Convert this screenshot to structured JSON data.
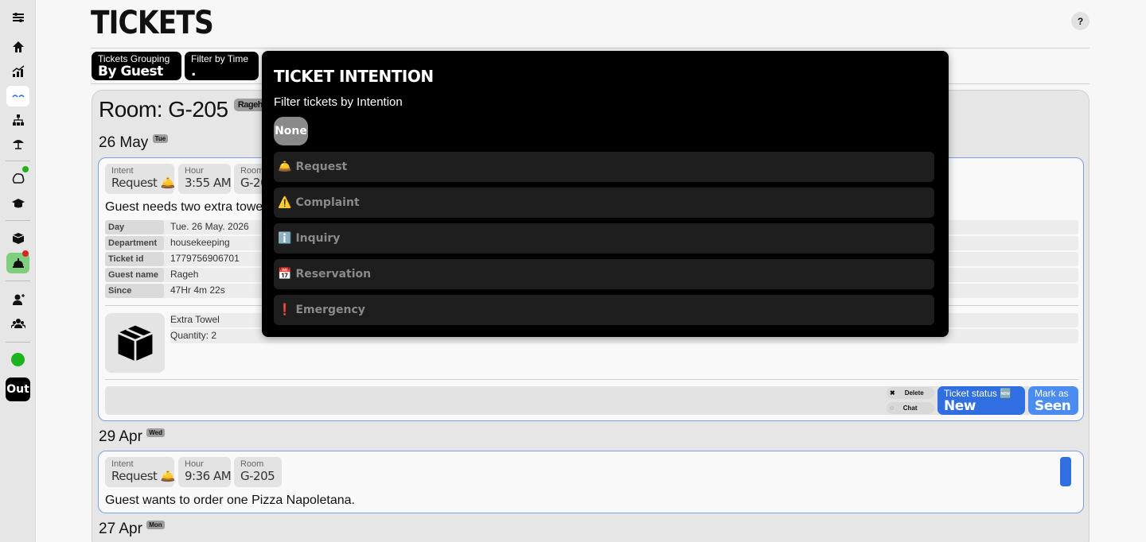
{
  "header": {
    "title": "TICKETS",
    "help_label": "?"
  },
  "filters": {
    "grouping": {
      "label": "Tickets Grouping",
      "value": "By Guest"
    },
    "time": {
      "label": "Filter by Time",
      "value": "."
    }
  },
  "sidebar": {
    "items": [
      "menu-icon",
      "home-icon",
      "chart-icon",
      "logo-icon",
      "org-chart-icon",
      "beach-umbrella-icon",
      "brain-icon",
      "graduation-cap-icon",
      "box-icon",
      "bell-service-icon",
      "user-icon",
      "group-icon"
    ],
    "out_label": "Out",
    "status_color": "#1db31d"
  },
  "room": {
    "title": "Room: G-205",
    "guest_tag": "Rageh"
  },
  "groups": [
    {
      "date": "26 May",
      "weekday": "Tue",
      "ticket": {
        "intent_label": "Intent",
        "intent_value": "Request 🛎️",
        "hour_label": "Hour",
        "hour_value": "3:55 AM",
        "room_label": "Room",
        "room_value": "G-20",
        "description": "Guest needs two extra towe",
        "details": [
          {
            "key": "Day",
            "value": "Tue. 26 May. 2026"
          },
          {
            "key": "Department",
            "value": "housekeeping"
          },
          {
            "key": "Ticket id",
            "value": "1779756906701"
          },
          {
            "key": "Guest name",
            "value": "Rageh"
          },
          {
            "key": "Since",
            "value": "47Hr 4m 22s"
          }
        ],
        "item_name": "Extra Towel",
        "item_quantity": "Quantity: 2",
        "delete_label": "Delete",
        "chat_label": "Chat",
        "status_label": "Ticket status 🆕",
        "status_value": "New",
        "seen_label": "Mark as",
        "seen_value": "Seen"
      }
    },
    {
      "date": "29 Apr",
      "weekday": "Wed",
      "ticket": {
        "intent_label": "Intent",
        "intent_value": "Request 🛎️",
        "hour_label": "Hour",
        "hour_value": "9:36 AM",
        "room_label": "Room",
        "room_value": "G-205",
        "description": "Guest wants to order one Pizza Napoletana."
      }
    },
    {
      "date": "27 Apr",
      "weekday": "Mon"
    }
  ],
  "modal": {
    "title": "TICKET INTENTION",
    "subtitle": "Filter tickets by Intention",
    "none_label": "None",
    "options": [
      {
        "icon": "🛎️",
        "label": "Request"
      },
      {
        "icon": "⚠️",
        "label": "Complaint"
      },
      {
        "icon": "ℹ️",
        "label": "Inquiry"
      },
      {
        "icon": "📅",
        "label": "Reservation"
      },
      {
        "icon": "❗",
        "label": "Emergency"
      }
    ]
  }
}
